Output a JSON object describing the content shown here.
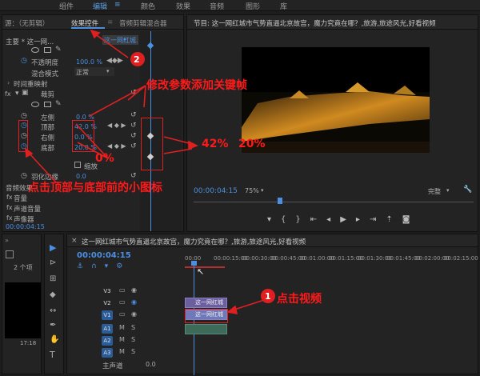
{
  "workspace_tabs": [
    "组件",
    "编辑",
    "颜色",
    "效果",
    "音频",
    "图形",
    "库"
  ],
  "source_panel": {
    "tabs": [
      "源：（无剪辑）",
      "效果控件",
      "音频剪辑混合器"
    ],
    "clip_master": "主要 * 这一网...",
    "clip_name": "这一网红城...",
    "opacity_label": "不透明度",
    "opacity_value": "100.0 %",
    "blend_label": "混合模式",
    "blend_value": "正常",
    "time_remap": "时间重映射",
    "crop_label": "裁剪",
    "rows": [
      {
        "label": "左侧",
        "value": "0.0 %"
      },
      {
        "label": "顶部",
        "value": "42.0 %"
      },
      {
        "label": "右侧",
        "value": "0.0 %"
      },
      {
        "label": "底部",
        "value": "20.0 %"
      }
    ],
    "zoom_label": "缩放",
    "feather_label": "羽化边缘",
    "feather_value": "0.0",
    "audio_effects": "音频效果",
    "audio_rows": [
      "音量",
      "声道音量",
      "声像器"
    ],
    "timecode": "00:00:04:15"
  },
  "program_panel": {
    "title": "节目: 这一网红城市气势直逼北京故宫，魔力究竟在哪？,旅游,旅途风光,好看视频",
    "timecode": "00:00:04:15",
    "zoom": "75%",
    "quality": "完整"
  },
  "timeline": {
    "title": "这一网红城市气势直逼北京故宫，魔力究竟在哪？,旅游,旅途风光,好看视频",
    "timecode": "00:00:04:15",
    "ruler": [
      "00:00",
      "00:00:15:00",
      "00:00:30:00",
      "00:00:45:00",
      "00:01:00:00",
      "00:01:15:00",
      "00:01:30:00",
      "00:01:45:00",
      "00:02:00:00",
      "00:02:15:00"
    ],
    "video_tracks": [
      "V3",
      "V2",
      "V1"
    ],
    "audio_tracks": [
      "A1",
      "A2",
      "A3"
    ],
    "master": "主声道",
    "master_value": "0.0",
    "clip_label": "这一网红城",
    "clip_label2": "这一网红城"
  },
  "project_panel": {
    "count": "2 个项",
    "duration": "17:18"
  },
  "annotations": {
    "step1": "点击视频",
    "step2_num": "2",
    "step1_num": "1",
    "modify": "修改参数添加关键帧",
    "pct_zero": "0%",
    "pct_42": "42%",
    "pct_20": "20%",
    "click_icons": "点击顶部与底部前的小图标"
  }
}
